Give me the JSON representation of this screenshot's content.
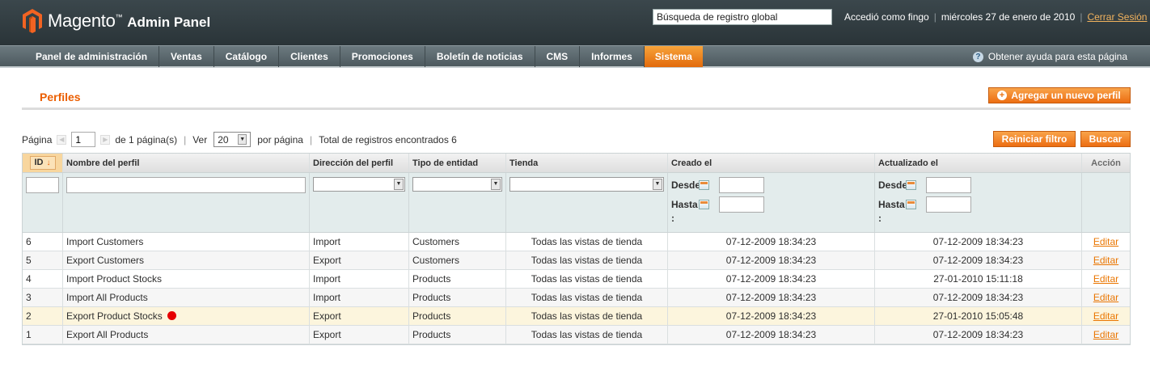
{
  "header": {
    "brand": "Magento",
    "brand_tm": "™",
    "subtitle": "Admin Panel",
    "search_value": "Búsqueda de registro global",
    "logged_in": "Accedió como fingo",
    "date": "miércoles 27 de enero de 2010",
    "logout": "Cerrar Sesión"
  },
  "nav": {
    "items": [
      "Panel de administración",
      "Ventas",
      "Catálogo",
      "Clientes",
      "Promociones",
      "Boletín de noticias",
      "CMS",
      "Informes",
      "Sistema"
    ],
    "active": "Sistema",
    "help": "Obtener ayuda para esta página"
  },
  "page": {
    "title": "Perfiles",
    "add_button": "Agregar un nuevo perfil",
    "reset_button": "Reiniciar filtro",
    "search_button": "Buscar"
  },
  "pager": {
    "page_label": "Página",
    "page_value": "1",
    "of_pages": "de 1 página(s)",
    "view_label": "Ver",
    "per_page": "20",
    "per_page_label": "por página",
    "total": "Total de registros encontrados 6"
  },
  "grid": {
    "columns": [
      "ID",
      "Nombre del perfil",
      "Dirección del perfil",
      "Tipo de entidad",
      "Tienda",
      "Creado el",
      "Actualizado el",
      "Acción"
    ],
    "filter": {
      "from": "Desde",
      "to": "Hasta",
      "colon": ":"
    },
    "rows": [
      {
        "id": "6",
        "name": "Import Customers",
        "direction": "Import",
        "entity": "Customers",
        "store": "Todas las vistas de tienda",
        "created": "07-12-2009 18:34:23",
        "updated": "07-12-2009 18:34:23",
        "action": "Editar"
      },
      {
        "id": "5",
        "name": "Export Customers",
        "direction": "Export",
        "entity": "Customers",
        "store": "Todas las vistas de tienda",
        "created": "07-12-2009 18:34:23",
        "updated": "07-12-2009 18:34:23",
        "action": "Editar"
      },
      {
        "id": "4",
        "name": "Import Product Stocks",
        "direction": "Import",
        "entity": "Products",
        "store": "Todas las vistas de tienda",
        "created": "07-12-2009 18:34:23",
        "updated": "27-01-2010 15:11:18",
        "action": "Editar"
      },
      {
        "id": "3",
        "name": "Import All Products",
        "direction": "Import",
        "entity": "Products",
        "store": "Todas las vistas de tienda",
        "created": "07-12-2009 18:34:23",
        "updated": "07-12-2009 18:34:23",
        "action": "Editar"
      },
      {
        "id": "2",
        "name": "Export Product Stocks",
        "direction": "Export",
        "entity": "Products",
        "store": "Todas las vistas de tienda",
        "created": "07-12-2009 18:34:23",
        "updated": "27-01-2010 15:05:48",
        "action": "Editar"
      },
      {
        "id": "1",
        "name": "Export All Products",
        "direction": "Export",
        "entity": "Products",
        "store": "Todas las vistas de tienda",
        "created": "07-12-2009 18:34:23",
        "updated": "07-12-2009 18:34:23",
        "action": "Editar"
      }
    ]
  },
  "colors": {
    "accent": "#eb5e00",
    "header_bg": "#2f3b3f",
    "marker": "#e60000"
  },
  "icons": [
    "magento-logo-icon",
    "help-icon",
    "plus-icon",
    "calendar-icon",
    "sort-desc-icon",
    "red-dot-icon"
  ]
}
